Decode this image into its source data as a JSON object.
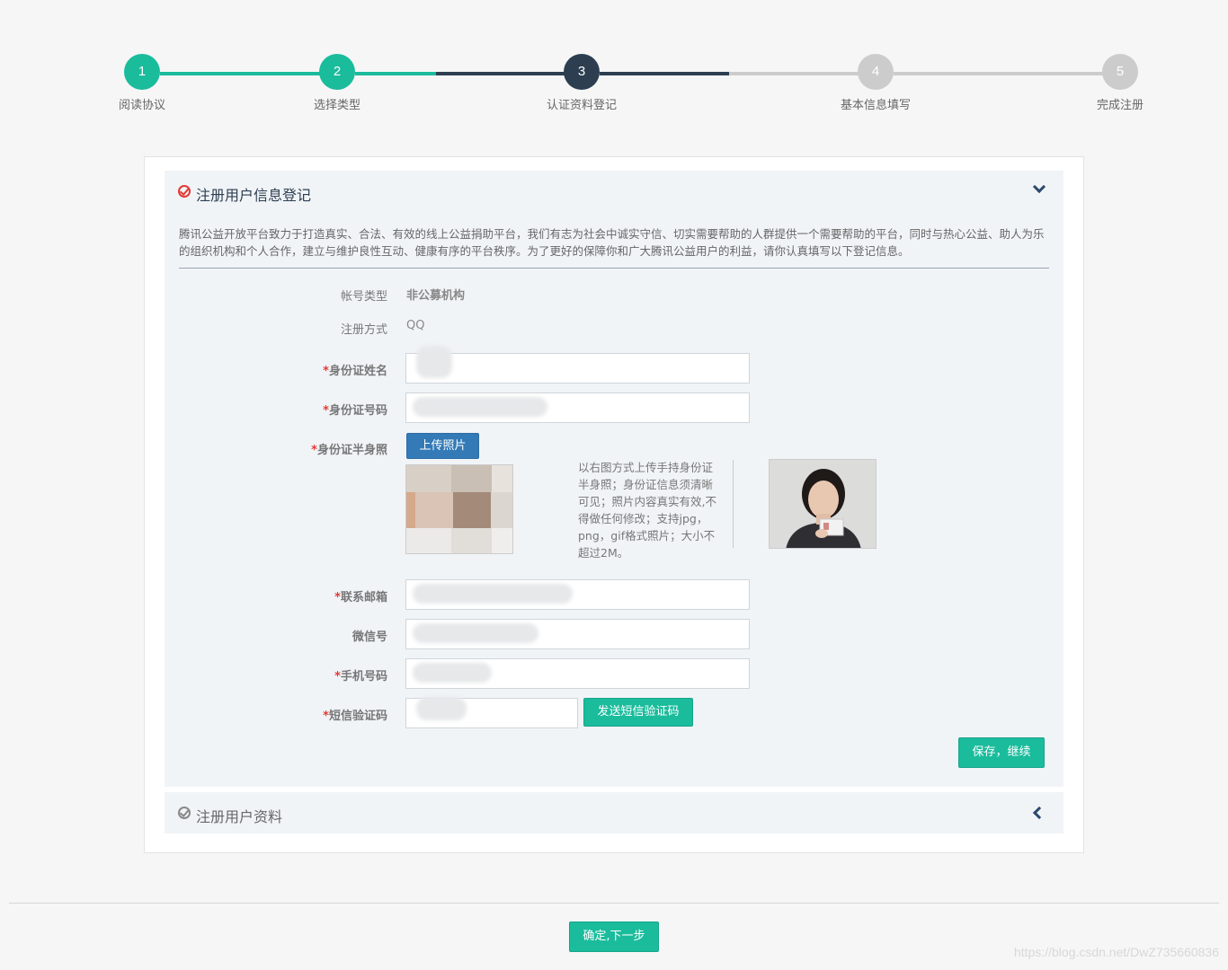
{
  "stepper": {
    "steps": [
      {
        "number": "1",
        "label": "阅读协议",
        "state": "done"
      },
      {
        "number": "2",
        "label": "选择类型",
        "state": "done"
      },
      {
        "number": "3",
        "label": "认证资料登记",
        "state": "current"
      },
      {
        "number": "4",
        "label": "基本信息填写",
        "state": "pending"
      },
      {
        "number": "5",
        "label": "完成注册",
        "state": "pending"
      }
    ],
    "colors": {
      "done": "#1abc9c",
      "current": "#2c3e50",
      "pending": "#cccccc"
    }
  },
  "panel1": {
    "title": "注册用户信息登记",
    "intro": "腾讯公益开放平台致力于打造真实、合法、有效的线上公益捐助平台，我们有志为社会中诚实守信、切实需要帮助的人群提供一个需要帮助的平台，同时与热心公益、助人为乐的组织机构和个人合作，建立与维护良性互动、健康有序的平台秩序。为了更好的保障你和广大腾讯公益用户的利益，请你认真填写以下登记信息。"
  },
  "form": {
    "account_type_label": "帐号类型",
    "account_type_value": "非公募机构",
    "register_method_label": "注册方式",
    "register_method_value": "QQ",
    "required_mark": "*",
    "id_name_label": "身份证姓名",
    "id_number_label": "身份证号码",
    "id_photo_label": "身份证半身照",
    "upload_button": "上传照片",
    "photo_hint": "以右图方式上传手持身份证半身照；身份证信息须清晰可见；照片内容真实有效,不得做任何修改；支持jpg，png，gif格式照片；大小不超过2M。",
    "email_label": "联系邮箱",
    "wechat_label": "微信号",
    "phone_label": "手机号码",
    "sms_label": "短信验证码",
    "send_sms_button": "发送短信验证码",
    "save_button": "保存，继续"
  },
  "panel2": {
    "title": "注册用户资料"
  },
  "footer": {
    "next_button": "确定,下一步",
    "watermark": "https://blog.csdn.net/DwZ735660836"
  }
}
